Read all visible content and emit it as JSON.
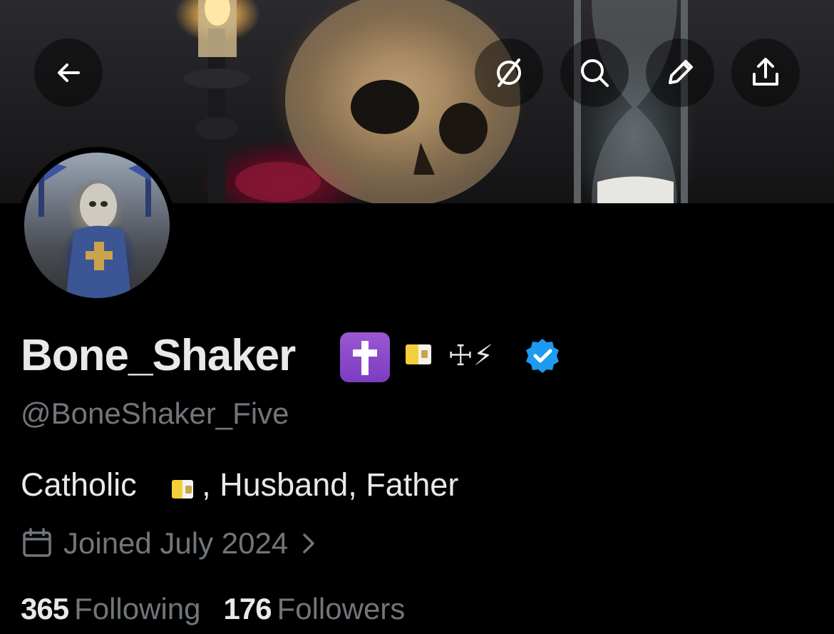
{
  "profile": {
    "display_name": "Bone_Shaker",
    "name_badges": [
      "latin-cross-emoji",
      "vatican-flag-emoji",
      "symbols-text",
      "verified-badge"
    ],
    "name_symbols": "☩⚡",
    "handle": "@BoneShaker_Five",
    "bio_part1": "Catholic",
    "bio_part2": ", Husband, Father",
    "joined": "Joined July 2024",
    "following_count": "365",
    "following_label": "Following",
    "followers_count": "176",
    "followers_label": "Followers"
  },
  "header_actions": {
    "back": "back-arrow-icon",
    "grok": "slash-circle-icon",
    "search": "search-icon",
    "edit": "pencil-icon",
    "share": "share-icon"
  },
  "colors": {
    "background": "#000000",
    "text_primary": "#e7e9ea",
    "text_secondary": "#71767b",
    "verified": "#1d9bf0",
    "cross_badge": "#8e4bcb"
  }
}
